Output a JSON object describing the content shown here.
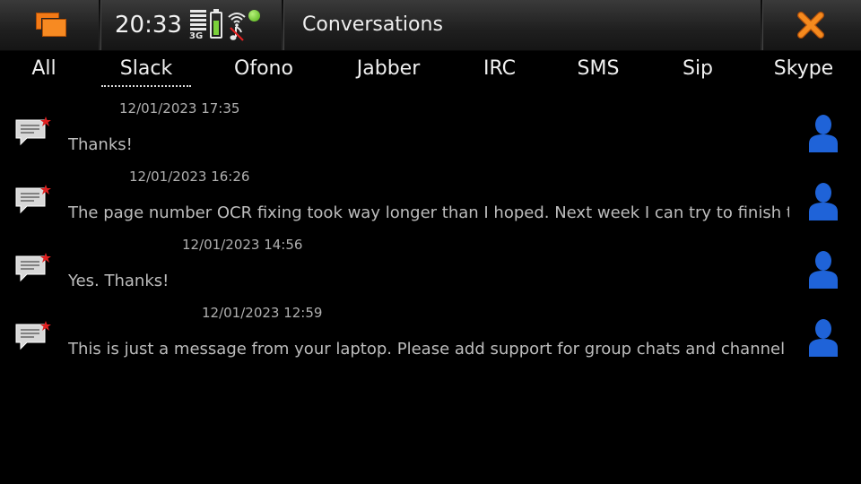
{
  "status_bar": {
    "time": "20:33",
    "network_type": "3G",
    "title": "Conversations",
    "icons": [
      "task-switcher-icon",
      "signal-strength-icon",
      "battery-icon",
      "wifi-icon",
      "mute-icon",
      "presence-online-icon",
      "close-icon"
    ],
    "battery_level": 0.75
  },
  "tabs": [
    {
      "label": "All"
    },
    {
      "label": "Slack",
      "selected": true
    },
    {
      "label": "Ofono"
    },
    {
      "label": "Jabber"
    },
    {
      "label": "IRC"
    },
    {
      "label": "SMS"
    },
    {
      "label": "Sip"
    },
    {
      "label": "Skype"
    }
  ],
  "messages": [
    {
      "timestamp": "12/01/2023 17:35",
      "text": "Thanks!"
    },
    {
      "timestamp": "12/01/2023 16:26",
      "text": "The page number OCR fixing took way longer than I hoped. Next week I can try to finish the correcti"
    },
    {
      "timestamp": "12/01/2023 14:56",
      "text": "Yes. Thanks!"
    },
    {
      "timestamp": "12/01/2023 12:59",
      "text": "This is just a message from your laptop. Please add support for group chats and channel listings soo"
    }
  ],
  "colors": {
    "accent": "#f47a16",
    "presence": "#4fae13",
    "battery": "#7bd13a",
    "avatar": "#1f63d8",
    "unread_star": "#e02020",
    "background": "#000000"
  }
}
